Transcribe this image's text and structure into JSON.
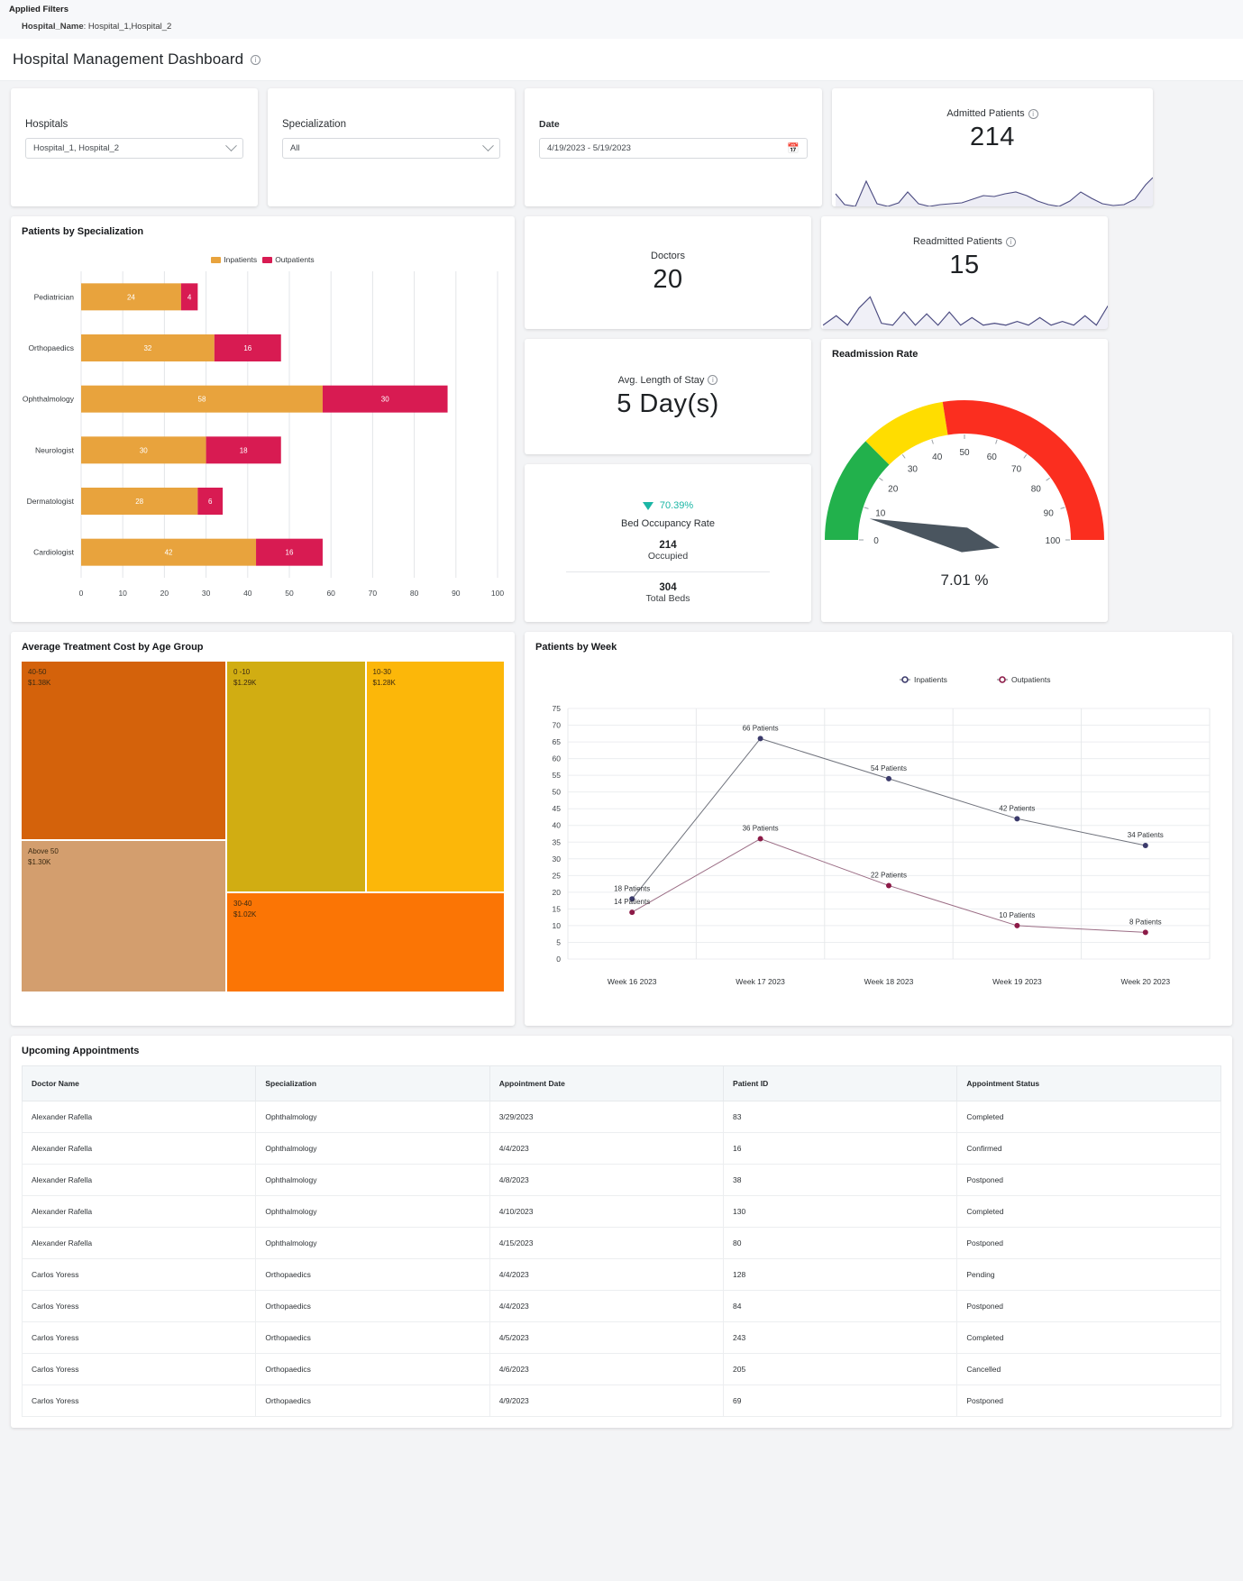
{
  "applied_filters": {
    "title": "Applied Filters",
    "filter_key": "Hospital_Name",
    "filter_sep": ": ",
    "filter_value": "Hospital_1,Hospital_2"
  },
  "header": {
    "title": "Hospital Management Dashboard"
  },
  "filters": {
    "hospitals": {
      "label": "Hospitals",
      "value": "Hospital_1, Hospital_2"
    },
    "specialization": {
      "label": "Specialization",
      "value": "All"
    },
    "date": {
      "label": "Date",
      "value": "4/19/2023 - 5/19/2023"
    }
  },
  "kpis": {
    "admitted": {
      "label": "Admitted Patients",
      "value": "214"
    },
    "readmitted": {
      "label": "Readmitted Patients",
      "value": "15"
    },
    "doctors": {
      "label": "Doctors",
      "value": "20"
    },
    "avg_stay": {
      "label": "Avg. Length of Stay",
      "value": "5 Day(s)"
    }
  },
  "bed_occupancy": {
    "percent": "70.39%",
    "label": "Bed Occupancy Rate",
    "occupied_value": "214",
    "occupied_label": "Occupied",
    "total_value": "304",
    "total_label": "Total Beds"
  },
  "readmission": {
    "title": "Readmission Rate",
    "value_text": "7.01 %"
  },
  "panels": {
    "specialization_title": "Patients by Specialization",
    "treemap_title": "Average Treatment Cost by Age Group",
    "week_title": "Patients by Week",
    "appointments_title": "Upcoming Appointments"
  },
  "chart_data": [
    {
      "type": "bar",
      "title": "Patients by Specialization",
      "orientation": "horizontal",
      "stacked": true,
      "categories": [
        "Pediatrician",
        "Orthopaedics",
        "Ophthalmology",
        "Neurologist",
        "Dermatologist",
        "Cardiologist"
      ],
      "series": [
        {
          "name": "Inpatients",
          "color": "#e8a33d",
          "values": [
            24,
            32,
            58,
            30,
            28,
            42
          ]
        },
        {
          "name": "Outpatients",
          "color": "#d81b52",
          "values": [
            4,
            16,
            30,
            18,
            6,
            16
          ]
        }
      ],
      "xlabel": "",
      "ylabel": "",
      "xlim": [
        0,
        100
      ],
      "xticks": [
        0,
        10,
        20,
        30,
        40,
        50,
        60,
        70,
        80,
        90,
        100
      ],
      "grid": true,
      "legend_position": "top"
    },
    {
      "type": "gauge",
      "title": "Readmission Rate",
      "value": 7.01,
      "value_text": "7.01 %",
      "min": 0,
      "max": 100,
      "ticks": [
        0,
        10,
        20,
        30,
        40,
        50,
        60,
        70,
        80,
        90,
        100
      ],
      "bands": [
        {
          "from": 0,
          "to": 25,
          "color": "#22b14c"
        },
        {
          "from": 25,
          "to": 45,
          "color": "#ffdd00"
        },
        {
          "from": 45,
          "to": 100,
          "color": "#fb2e1f"
        }
      ]
    },
    {
      "type": "treemap",
      "title": "Average Treatment Cost by Age Group",
      "items": [
        {
          "label": "40-50",
          "value_text": "$1.38K",
          "value": 1380,
          "color": "#d4620b"
        },
        {
          "label": "Above 50",
          "value_text": "$1.30K",
          "value": 1300,
          "color": "#d39e6e"
        },
        {
          "label": "0 -10",
          "value_text": "$1.29K",
          "value": 1290,
          "color": "#d1ad12"
        },
        {
          "label": "30-40",
          "value_text": "$1.02K",
          "value": 1020,
          "color": "#fb7505"
        },
        {
          "label": "10-30",
          "value_text": "$1.28K",
          "value": 1280,
          "color": "#fcb709"
        }
      ]
    },
    {
      "type": "line",
      "title": "Patients by Week",
      "x": [
        "Week 16 2023",
        "Week 17 2023",
        "Week 18 2023",
        "Week 19 2023",
        "Week 20 2023"
      ],
      "series": [
        {
          "name": "Inpatients",
          "color": "#3b3a6b",
          "values": [
            18,
            66,
            54,
            42,
            34
          ],
          "labels": [
            "18 Patients",
            "66 Patients",
            "54 Patients",
            "42 Patients",
            "34 Patients"
          ]
        },
        {
          "name": "Outpatients",
          "color": "#8c1a47",
          "values": [
            14,
            36,
            22,
            10,
            8
          ],
          "labels": [
            "14 Patients",
            "36 Patients",
            "22 Patients",
            "10 Patients",
            "8 Patients"
          ]
        }
      ],
      "ylim": [
        0,
        75
      ],
      "yticks": [
        0,
        5,
        10,
        15,
        20,
        25,
        30,
        35,
        40,
        45,
        50,
        55,
        60,
        65,
        70,
        75
      ],
      "grid": true,
      "legend_position": "top"
    }
  ],
  "appointments": {
    "columns": [
      "Doctor Name",
      "Specialization",
      "Appointment Date",
      "Patient ID",
      "Appointment Status"
    ],
    "rows": [
      [
        "Alexander Rafella",
        "Ophthalmology",
        "3/29/2023",
        "83",
        "Completed"
      ],
      [
        "Alexander Rafella",
        "Ophthalmology",
        "4/4/2023",
        "16",
        "Confirmed"
      ],
      [
        "Alexander Rafella",
        "Ophthalmology",
        "4/8/2023",
        "38",
        "Postponed"
      ],
      [
        "Alexander Rafella",
        "Ophthalmology",
        "4/10/2023",
        "130",
        "Completed"
      ],
      [
        "Alexander Rafella",
        "Ophthalmology",
        "4/15/2023",
        "80",
        "Postponed"
      ],
      [
        "Carlos Yoress",
        "Orthopaedics",
        "4/4/2023",
        "128",
        "Pending"
      ],
      [
        "Carlos Yoress",
        "Orthopaedics",
        "4/4/2023",
        "84",
        "Postponed"
      ],
      [
        "Carlos Yoress",
        "Orthopaedics",
        "4/5/2023",
        "243",
        "Completed"
      ],
      [
        "Carlos Yoress",
        "Orthopaedics",
        "4/6/2023",
        "205",
        "Cancelled"
      ],
      [
        "Carlos Yoress",
        "Orthopaedics",
        "4/9/2023",
        "69",
        "Postponed"
      ]
    ]
  },
  "icons": {
    "info": "info-icon",
    "chevron": "chevron-down-icon",
    "calendar": "calendar-icon"
  }
}
